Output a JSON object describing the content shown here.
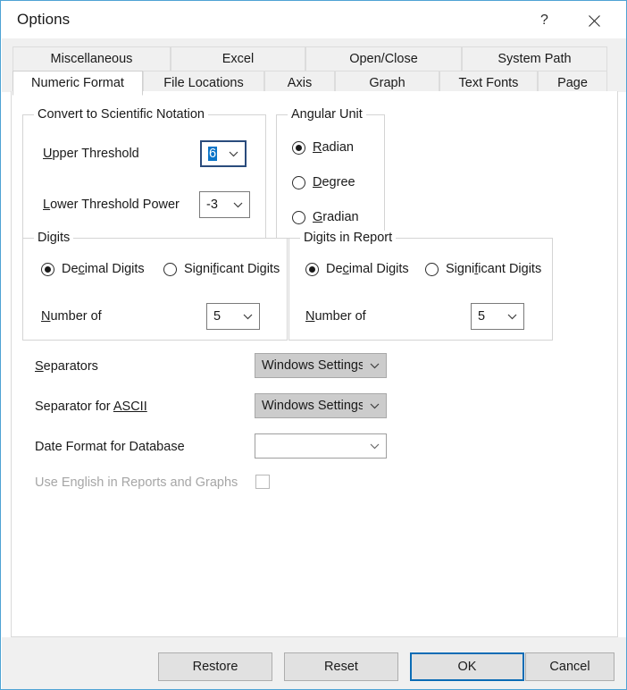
{
  "window": {
    "title": "Options",
    "help_icon": "question-mark-icon",
    "close_icon": "close-icon",
    "help_glyph": "?",
    "accent_border": "#4ea3d4"
  },
  "tabs": {
    "row1": [
      {
        "label": "Miscellaneous",
        "selected": false
      },
      {
        "label": "Excel",
        "selected": false
      },
      {
        "label": "Open/Close",
        "selected": false
      },
      {
        "label": "System Path",
        "selected": false
      }
    ],
    "row2": [
      {
        "label": "Numeric Format",
        "selected": true
      },
      {
        "label": "File Locations",
        "selected": false
      },
      {
        "label": "Axis",
        "selected": false
      },
      {
        "label": "Graph",
        "selected": false
      },
      {
        "label": "Text Fonts",
        "selected": false
      },
      {
        "label": "Page",
        "selected": false
      }
    ]
  },
  "scientific_notation": {
    "group_title": "Convert to Scientific Notation",
    "upper_threshold": {
      "label_pre": "",
      "label_mnemonic": "U",
      "label_post": "pper Threshold",
      "value": "6",
      "selected": true,
      "focused": true
    },
    "lower_threshold": {
      "label_pre": "",
      "label_mnemonic": "L",
      "label_post": "ower Threshold Power",
      "value": "-3"
    }
  },
  "angular_unit": {
    "group_title": "Angular Unit",
    "options": [
      {
        "pre": "",
        "mnemonic": "R",
        "post": "adian",
        "checked": true
      },
      {
        "pre": "",
        "mnemonic": "D",
        "post": "egree",
        "checked": false
      },
      {
        "pre": "",
        "mnemonic": "G",
        "post": "radian",
        "checked": false
      }
    ]
  },
  "digits": {
    "group_title": "Digits",
    "decimal": {
      "pre": "De",
      "mnemonic": "c",
      "post": "imal Digits",
      "checked": true
    },
    "significant": {
      "pre": "Signi",
      "mnemonic": "f",
      "post": "icant Digits",
      "checked": false
    },
    "number_of": {
      "pre": "",
      "mnemonic": "N",
      "post": "umber of",
      "value": "5"
    }
  },
  "digits_in_report": {
    "group_title": "Digits in Report",
    "decimal": {
      "pre": "De",
      "mnemonic": "c",
      "post": "imal Digits",
      "checked": true
    },
    "significant": {
      "pre": "Signi",
      "mnemonic": "f",
      "post": "icant Digits",
      "checked": false
    },
    "number_of": {
      "pre": "",
      "mnemonic": "N",
      "post": "umber of",
      "value": "5"
    }
  },
  "misc_rows": {
    "separators": {
      "label_pre": "",
      "label_mnemonic": "S",
      "label_post": "eparators",
      "value": "Windows Settings",
      "style": "gray"
    },
    "separator_ascii": {
      "label_pre": "Separator for ",
      "label_mnemonic": "ASCII",
      "label_post": "",
      "value": "Windows Settings",
      "style": "gray"
    },
    "date_format": {
      "label": "Date Format for Database",
      "value": "",
      "style": "white"
    },
    "use_english": {
      "label": "Use English in Reports and Graphs",
      "checked": false,
      "disabled": true
    }
  },
  "buttons": {
    "restore": "Restore",
    "reset": "Reset",
    "ok": "OK",
    "cancel": "Cancel"
  }
}
